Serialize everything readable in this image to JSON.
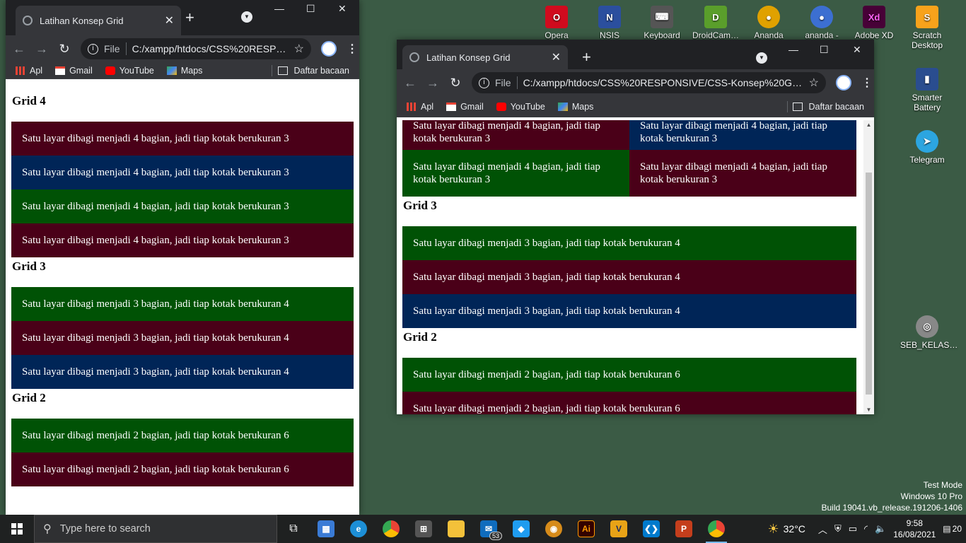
{
  "desktop": {
    "icons_top": [
      {
        "label": "Opera",
        "icon": "opera-icon",
        "color": "#d00b1e",
        "glyph": "O"
      },
      {
        "label": "NSIS",
        "icon": "nsis-icon",
        "color": "#2b4f9e",
        "glyph": "N"
      },
      {
        "label": "Keyboard",
        "icon": "keyboard-icon",
        "color": "#555555",
        "glyph": "⌨"
      },
      {
        "label": "DroidCam…",
        "icon": "droidcam-icon",
        "color": "#5a9e2b",
        "glyph": "D"
      },
      {
        "label": "Ananda",
        "icon": "chrome-profile-icon",
        "color": "#e0a100",
        "glyph": "●"
      },
      {
        "label": "ananda -",
        "icon": "chrome-profile-icon",
        "color": "#3c6fd1",
        "glyph": "●"
      },
      {
        "label": "Adobe XD",
        "icon": "adobe-xd-icon",
        "color": "#470137",
        "glyph": "Xd"
      },
      {
        "label": "Scratch Desktop",
        "icon": "scratch-icon",
        "color": "#f7a21b",
        "glyph": "S"
      }
    ],
    "icons_right": [
      {
        "label": "Smarter Battery",
        "icon": "battery-icon",
        "color": "#2a4d8f",
        "glyph": "▮"
      },
      {
        "label": "Telegram",
        "icon": "telegram-icon",
        "color": "#2ca5e0",
        "glyph": "➤"
      },
      {
        "label": "SEB_KELAS…",
        "icon": "seb-icon",
        "color": "#888888",
        "glyph": "◎"
      }
    ],
    "watermark": [
      "Test Mode",
      "Windows 10 Pro",
      "Build 19041.vb_release.191206-1406"
    ]
  },
  "browser_left": {
    "tab_title": "Latihan Konsep Grid",
    "file_label": "File",
    "url": "C:/xampp/htdocs/CSS%20RESP…",
    "bookmarks": [
      {
        "label": "Apl",
        "icon": "apps-icon"
      },
      {
        "label": "Gmail",
        "icon": "gmail-icon"
      },
      {
        "label": "YouTube",
        "icon": "youtube-icon"
      },
      {
        "label": "Maps",
        "icon": "maps-icon"
      }
    ],
    "reading_list": "Daftar bacaan",
    "page": {
      "grid4_heading": "Grid 4",
      "grid4_items": [
        "Satu layar dibagi menjadi 4 bagian, jadi tiap kotak berukuran 3",
        "Satu layar dibagi menjadi 4 bagian, jadi tiap kotak berukuran 3",
        "Satu layar dibagi menjadi 4 bagian, jadi tiap kotak berukuran 3",
        "Satu layar dibagi menjadi 4 bagian, jadi tiap kotak berukuran 3"
      ],
      "grid3_heading": "Grid 3",
      "grid3_items": [
        "Satu layar dibagi menjadi 3 bagian, jadi tiap kotak berukuran 4",
        "Satu layar dibagi menjadi 3 bagian, jadi tiap kotak berukuran 4",
        "Satu layar dibagi menjadi 3 bagian, jadi tiap kotak berukuran 4"
      ],
      "grid2_heading": "Grid 2",
      "grid2_items": [
        "Satu layar dibagi menjadi 2 bagian, jadi tiap kotak berukuran 6",
        "Satu layar dibagi menjadi 2 bagian, jadi tiap kotak berukuran 6"
      ]
    }
  },
  "browser_right": {
    "tab_title": "Latihan Konsep Grid",
    "file_label": "File",
    "url": "C:/xampp/htdocs/CSS%20RESPONSIVE/CSS-Konsep%20Gri…",
    "bookmarks": [
      {
        "label": "Apl",
        "icon": "apps-icon"
      },
      {
        "label": "Gmail",
        "icon": "gmail-icon"
      },
      {
        "label": "YouTube",
        "icon": "youtube-icon"
      },
      {
        "label": "Maps",
        "icon": "maps-icon"
      }
    ],
    "reading_list": "Daftar bacaan",
    "page": {
      "grid4_items": [
        "Satu layar dibagi menjadi 4 bagian, jadi tiap kotak berukuran 3",
        "Satu layar dibagi menjadi 4 bagian, jadi tiap kotak berukuran 3",
        "Satu layar dibagi menjadi 4 bagian, jadi tiap kotak berukuran 3",
        "Satu layar dibagi menjadi 4 bagian, jadi tiap kotak berukuran 3"
      ],
      "grid3_heading": "Grid 3",
      "grid3_items": [
        "Satu layar dibagi menjadi 3 bagian, jadi tiap kotak berukuran 4",
        "Satu layar dibagi menjadi 3 bagian, jadi tiap kotak berukuran 4",
        "Satu layar dibagi menjadi 3 bagian, jadi tiap kotak berukuran 4"
      ],
      "grid2_heading": "Grid 2",
      "grid2_items": [
        "Satu layar dibagi menjadi 2 bagian, jadi tiap kotak berukuran 6",
        "Satu layar dibagi menjadi 2 bagian, jadi tiap kotak berukuran 6"
      ]
    }
  },
  "colors": {
    "box_red": "#4a0018",
    "box_blue": "#002557",
    "box_green": "#005205"
  },
  "taskbar": {
    "search_placeholder": "Type here to search",
    "mail_badge": "53",
    "weather": "32°C",
    "time": "9:58",
    "date": "16/08/2021",
    "notifications": "20"
  }
}
